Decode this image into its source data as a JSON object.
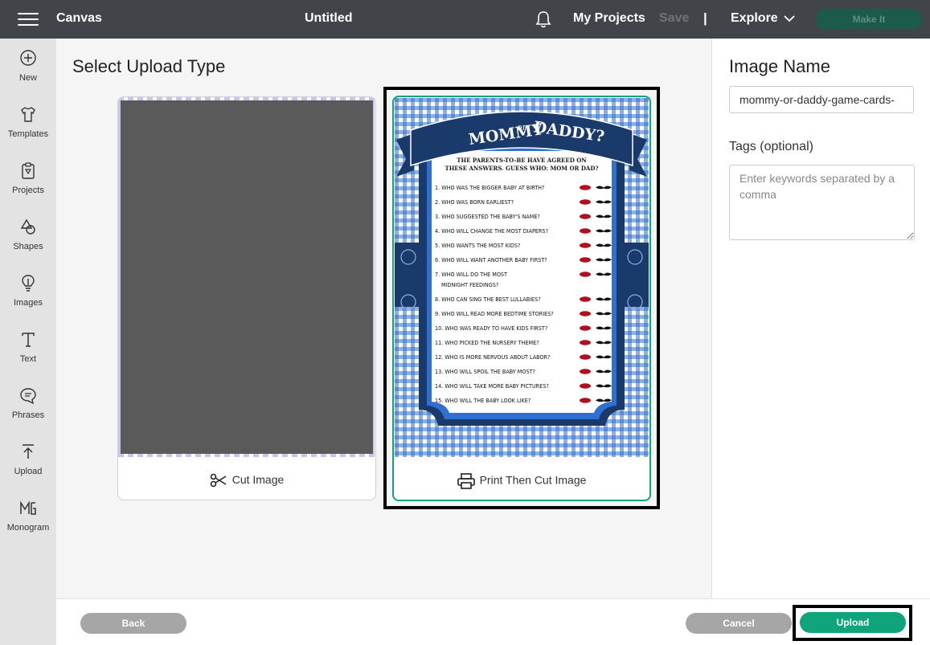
{
  "topbar": {
    "brand": "Canvas",
    "doc_title": "Untitled",
    "my_projects": "My Projects",
    "save": "Save",
    "separator": "|",
    "explore": "Explore",
    "make_it": "Make It"
  },
  "sidebar": {
    "items": [
      {
        "label": "New",
        "icon": "plus-circle-icon"
      },
      {
        "label": "Templates",
        "icon": "shirt-icon"
      },
      {
        "label": "Projects",
        "icon": "clipboard-icon"
      },
      {
        "label": "Shapes",
        "icon": "shapes-icon"
      },
      {
        "label": "Images",
        "icon": "lightbulb-icon"
      },
      {
        "label": "Text",
        "icon": "text-icon"
      },
      {
        "label": "Phrases",
        "icon": "speech-bubble-icon"
      },
      {
        "label": "Upload",
        "icon": "upload-icon"
      },
      {
        "label": "Monogram",
        "icon": "monogram-icon"
      }
    ]
  },
  "main": {
    "title": "Select Upload Type",
    "cut_card_label": "Cut Image",
    "print_card_label": "Print Then Cut Image"
  },
  "flyer": {
    "title_left": "MOMMY",
    "title_or": "or",
    "title_right": "DADDY?",
    "subtitle_1": "THE PARENTS-TO-BE HAVE AGREED ON",
    "subtitle_2": "THESE ANSWERS. GUESS WHO: MOM OR DAD?",
    "questions": [
      "1. WHO WAS THE BIGGER BABY AT BIRTH?",
      "2. WHO WAS BORN EARLIEST?",
      "3. WHO SUGGESTED THE BABY'S NAME?",
      "4. WHO WILL CHANGE THE MOST DIAPERS?",
      "5. WHO WANTS THE MOST KIDS?",
      "6. WHO WILL WANT ANOTHER BABY FIRST?",
      "7. WHO WILL DO THE MOST",
      "8. WHO CAN SING THE BEST LULLABIES?",
      "9. WHO WILL READ MORE BEDTIME STORIES?",
      "10. WHO WAS READY TO HAVE KIDS FIRST?",
      "11. WHO PICKED THE NURSERY THEME?",
      "12. WHO IS MORE NERVOUS ABOUT LABOR?",
      "13. WHO WILL SPOIL THE BABY MOST?",
      "14. WHO WILL TAKE MORE BABY PICTURES?",
      "15. WHO WILL THE BABY LOOK LIKE?"
    ],
    "q7_line2": "MIDNIGHT FEEDINGS?"
  },
  "right_panel": {
    "image_name_label": "Image Name",
    "image_name_value": "mommy-or-daddy-game-cards-",
    "tags_label": "Tags (optional)",
    "tags_placeholder": "Enter keywords separated by a comma"
  },
  "bottombar": {
    "back": "Back",
    "cancel": "Cancel",
    "upload": "Upload"
  },
  "colors": {
    "topbar": "#414549",
    "accent": "#0fa47a",
    "gingham": "#2f6fd0",
    "navy": "#1a3a6b"
  }
}
